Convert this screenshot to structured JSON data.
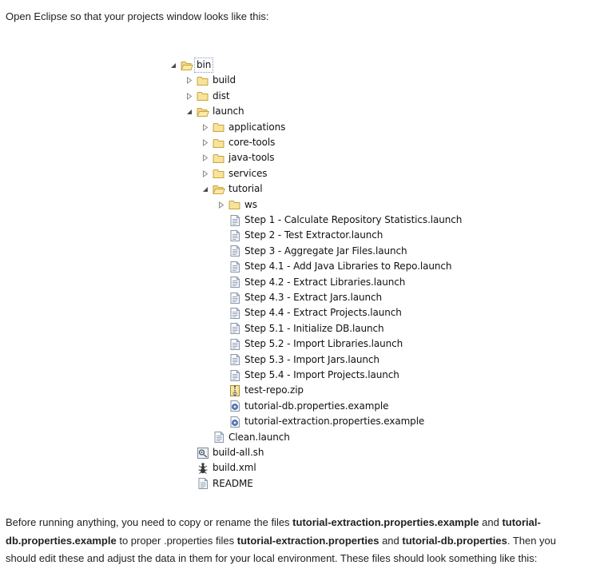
{
  "intro_text": "Open Eclipse so that your projects window looks like this:",
  "tree": [
    {
      "name": "bin",
      "depth": 0,
      "icon": "folder-open-icon",
      "toggle": "expanded",
      "selected": true
    },
    {
      "name": "build",
      "depth": 1,
      "icon": "folder-icon",
      "toggle": "collapsed"
    },
    {
      "name": "dist",
      "depth": 1,
      "icon": "folder-icon",
      "toggle": "collapsed"
    },
    {
      "name": "launch",
      "depth": 1,
      "icon": "folder-open-icon",
      "toggle": "expanded"
    },
    {
      "name": "applications",
      "depth": 2,
      "icon": "folder-icon",
      "toggle": "collapsed"
    },
    {
      "name": "core-tools",
      "depth": 2,
      "icon": "folder-icon",
      "toggle": "collapsed"
    },
    {
      "name": "java-tools",
      "depth": 2,
      "icon": "folder-icon",
      "toggle": "collapsed"
    },
    {
      "name": "services",
      "depth": 2,
      "icon": "folder-icon",
      "toggle": "collapsed"
    },
    {
      "name": "tutorial",
      "depth": 2,
      "icon": "folder-open-icon",
      "toggle": "expanded"
    },
    {
      "name": "ws",
      "depth": 3,
      "icon": "folder-icon",
      "toggle": "collapsed"
    },
    {
      "name": "Step 1 - Calculate Repository Statistics.launch",
      "depth": 3,
      "icon": "launch-file-icon",
      "toggle": "none"
    },
    {
      "name": "Step 2 - Test Extractor.launch",
      "depth": 3,
      "icon": "launch-file-icon",
      "toggle": "none"
    },
    {
      "name": "Step 3 - Aggregate Jar Files.launch",
      "depth": 3,
      "icon": "launch-file-icon",
      "toggle": "none"
    },
    {
      "name": "Step 4.1 - Add Java Libraries to Repo.launch",
      "depth": 3,
      "icon": "launch-file-icon",
      "toggle": "none"
    },
    {
      "name": "Step 4.2 - Extract Libraries.launch",
      "depth": 3,
      "icon": "launch-file-icon",
      "toggle": "none"
    },
    {
      "name": "Step 4.3 - Extract Jars.launch",
      "depth": 3,
      "icon": "launch-file-icon",
      "toggle": "none"
    },
    {
      "name": "Step 4.4 - Extract Projects.launch",
      "depth": 3,
      "icon": "launch-file-icon",
      "toggle": "none"
    },
    {
      "name": "Step 5.1 - Initialize DB.launch",
      "depth": 3,
      "icon": "launch-file-icon",
      "toggle": "none"
    },
    {
      "name": "Step 5.2 - Import Libraries.launch",
      "depth": 3,
      "icon": "launch-file-icon",
      "toggle": "none"
    },
    {
      "name": "Step 5.3 - Import Jars.launch",
      "depth": 3,
      "icon": "launch-file-icon",
      "toggle": "none"
    },
    {
      "name": "Step 5.4 - Import Projects.launch",
      "depth": 3,
      "icon": "launch-file-icon",
      "toggle": "none"
    },
    {
      "name": "test-repo.zip",
      "depth": 3,
      "icon": "zip-archive-icon",
      "toggle": "none"
    },
    {
      "name": "tutorial-db.properties.example",
      "depth": 3,
      "icon": "properties-file-icon",
      "toggle": "none"
    },
    {
      "name": "tutorial-extraction.properties.example",
      "depth": 3,
      "icon": "properties-file-icon",
      "toggle": "none"
    },
    {
      "name": "Clean.launch",
      "depth": 2,
      "icon": "launch-file-icon",
      "toggle": "none"
    },
    {
      "name": "build-all.sh",
      "depth": 1,
      "icon": "shell-script-icon",
      "toggle": "none"
    },
    {
      "name": "build.xml",
      "depth": 1,
      "icon": "ant-build-icon",
      "toggle": "none"
    },
    {
      "name": "README",
      "depth": 1,
      "icon": "text-file-icon",
      "toggle": "none"
    }
  ],
  "outro": {
    "p1": "Before running anything, you need to copy or rename the files ",
    "f1": "tutorial-extraction.properties.example",
    "p2": " and ",
    "f2": "tutorial-db.properties.example",
    "p3": " to proper .properties files ",
    "f3": "tutorial-extraction.properties",
    "p4": " and ",
    "f4": "tutorial-db.properties",
    "p5": ". Then you should edit these and adjust the data in them for your local environment. These files should look something like this:"
  },
  "colors": {
    "folder_fill": "#f7e39c",
    "folder_stroke": "#c9a43a",
    "selection_border": "#7a98c4",
    "toggle_arrow": "#4a4a4a"
  }
}
